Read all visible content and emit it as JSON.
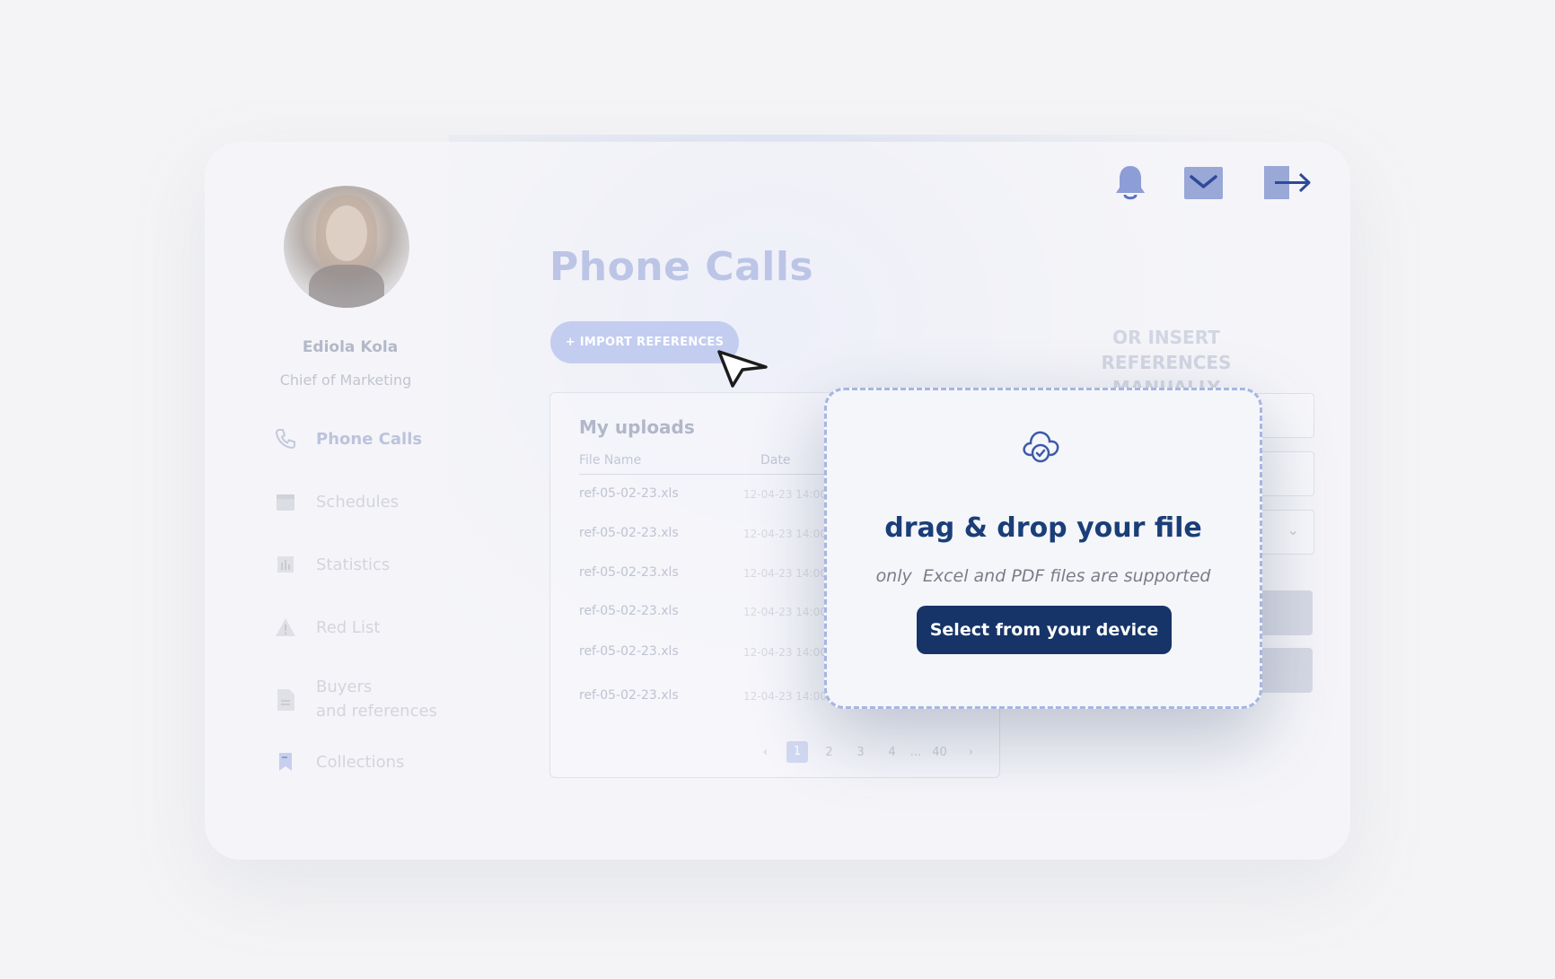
{
  "user": {
    "name": "Ediola Kola",
    "role": "Chief of Marketing"
  },
  "sidebar": {
    "items": [
      {
        "label": "Phone Calls",
        "icon": "phone-icon",
        "active": true
      },
      {
        "label": "Schedules",
        "icon": "calendar-icon"
      },
      {
        "label": "Statistics",
        "icon": "bar-chart-icon"
      },
      {
        "label": "Red List",
        "icon": "warning-icon"
      },
      {
        "label": "Buyers",
        "label2": "and references",
        "icon": "document-icon"
      },
      {
        "label": "Collections",
        "icon": "bookmark-icon"
      }
    ]
  },
  "header": {
    "icons": [
      "bell-icon",
      "mail-icon",
      "logout-icon"
    ]
  },
  "main": {
    "title": "Phone Calls",
    "import_button": "+ IMPORT REFERENCES",
    "uploads": {
      "title": "My uploads",
      "columns": [
        "File Name",
        "Date"
      ],
      "rows": [
        {
          "file": "ref-05-02-23.xls",
          "date": "12-04-23  14:00"
        },
        {
          "file": "ref-05-02-23.xls",
          "date": "12-04-23  14:00"
        },
        {
          "file": "ref-05-02-23.xls",
          "date": "12-04-23  14:00"
        },
        {
          "file": "ref-05-02-23.xls",
          "date": "12-04-23  14:00"
        },
        {
          "file": "ref-05-02-23.xls",
          "date": "12-04-23  14:00"
        },
        {
          "file": "ref-05-02-23.xls",
          "date": "12-04-23  14:00"
        }
      ],
      "pagination": {
        "prev": "‹",
        "pages": [
          "1",
          "2",
          "3",
          "4",
          "...",
          "40"
        ],
        "current": "1",
        "next": "›"
      }
    },
    "manual": {
      "title": "OR INSERT REFERENCES MANUALLY"
    }
  },
  "modal": {
    "icon": "cloud-check-icon",
    "title": "drag & drop your file",
    "subtitle": "only  Excel and PDF files are supported",
    "button": "Select from your device"
  },
  "colors": {
    "accent": "#163467",
    "title_blue": "#1a3e78",
    "dashed_border": "#a7b6e2",
    "icon_blue": "#3d5aa8"
  }
}
